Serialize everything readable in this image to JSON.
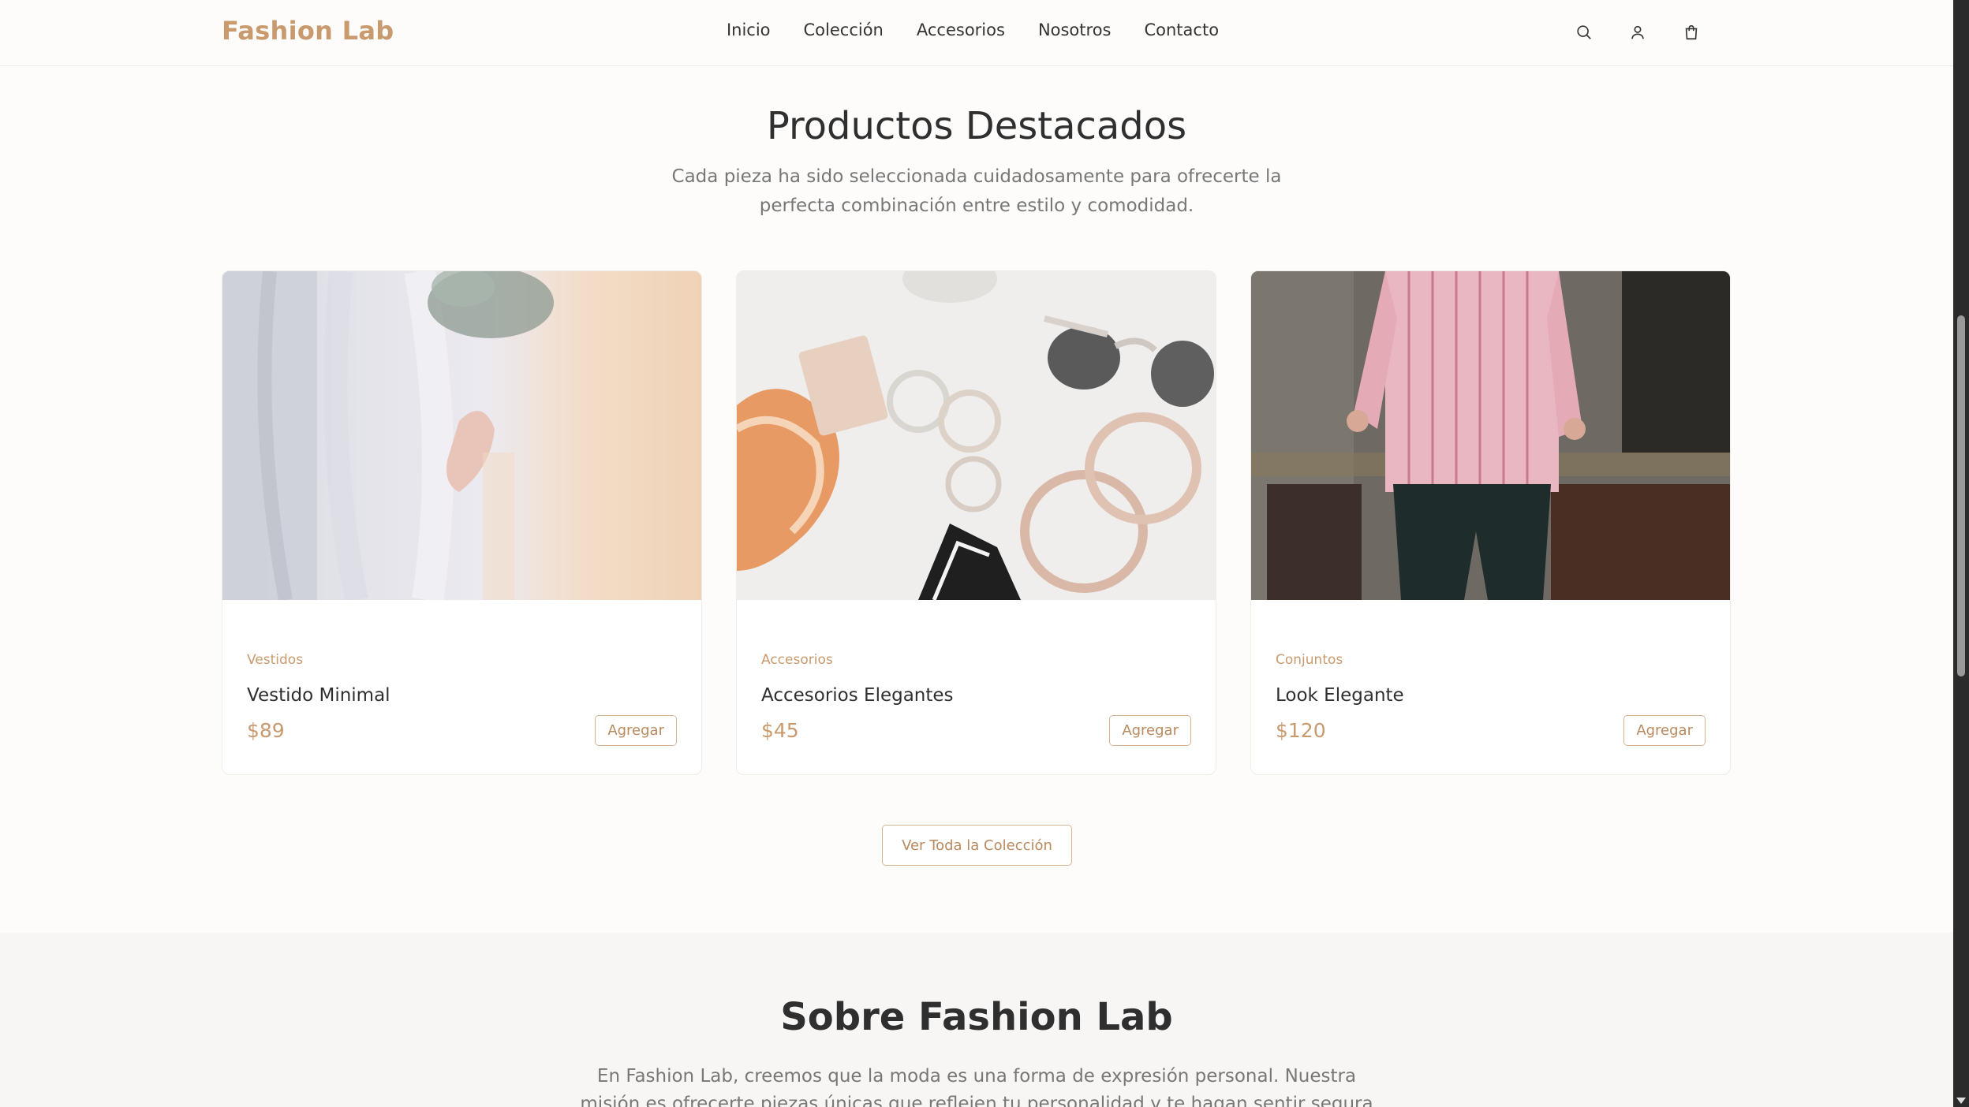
{
  "header": {
    "brand": "Fashion Lab",
    "nav": [
      "Inicio",
      "Colección",
      "Accesorios",
      "Nosotros",
      "Contacto"
    ],
    "icons": [
      "search-icon",
      "user-icon",
      "shopping-bag-icon"
    ],
    "accent": "#c89a6e"
  },
  "featured": {
    "title": "Productos Destacados",
    "subtitle": "Cada pieza ha sido seleccionada cuidadosamente para ofrecerte la perfecta combinación entre estilo y comodidad.",
    "products": [
      {
        "category": "Vestidos",
        "name": "Vestido Minimal",
        "price": "$89",
        "button": "Agregar"
      },
      {
        "category": "Accesorios",
        "name": "Accesorios Elegantes",
        "price": "$45",
        "button": "Agregar"
      },
      {
        "category": "Conjuntos",
        "name": "Look Elegante",
        "price": "$120",
        "button": "Agregar"
      }
    ],
    "view_all": "Ver Toda la Colección"
  },
  "about": {
    "title": "Sobre Fashion Lab",
    "text": "En Fashion Lab, creemos que la moda es una forma de expresión personal. Nuestra misión es ofrecerte piezas únicas que reflejen tu personalidad y te hagan sentir segura y elegante en"
  }
}
